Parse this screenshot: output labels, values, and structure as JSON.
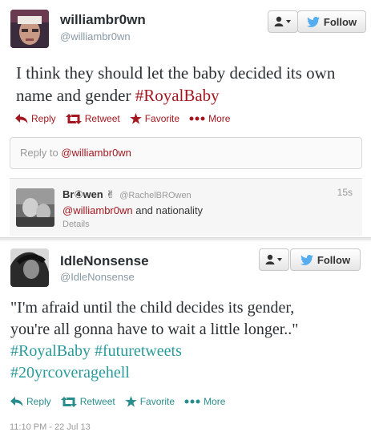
{
  "tweet1": {
    "name": "williambr0wn",
    "handle": "@williambr0wn",
    "follow_label": "Follow",
    "text": "I think they should let the baby decided its own name and gender ",
    "hashtag": "#RoyalBaby",
    "actions": {
      "reply": "Reply",
      "retweet": "Retweet",
      "favorite": "Favorite",
      "more": "More"
    },
    "reply_prefix": "Reply to ",
    "reply_mention": "@williambr0wn"
  },
  "reply": {
    "name": "Br④wen ✌",
    "handle": "@RachelBROwen",
    "time": "15s",
    "mention": "@williambr0wn",
    "text": " and nationality",
    "details": "Details"
  },
  "tweet2": {
    "name": "IdleNonsense",
    "handle": "@IdleNonsense",
    "follow_label": "Follow",
    "text_line1": "\"I'm afraid until the child decides its gender,",
    "text_line2": "you're all gonna have to wait a little longer..\"",
    "hashtag1": "#RoyalBaby",
    "hashtag2": "#futuretweets",
    "hashtag3": "#20yrcoveragehell",
    "actions": {
      "reply": "Reply",
      "retweet": "Retweet",
      "favorite": "Favorite",
      "more": "More"
    },
    "timestamp": "11:10 PM - 22 Jul 13"
  },
  "colors": {
    "accent_red": "#a31820",
    "accent_teal": "#2a9a9a",
    "twitter_blue": "#55acee"
  },
  "icons": [
    "user-dropdown-icon",
    "twitter-bird-icon",
    "reply-icon",
    "retweet-icon",
    "star-icon",
    "more-dots-icon"
  ]
}
